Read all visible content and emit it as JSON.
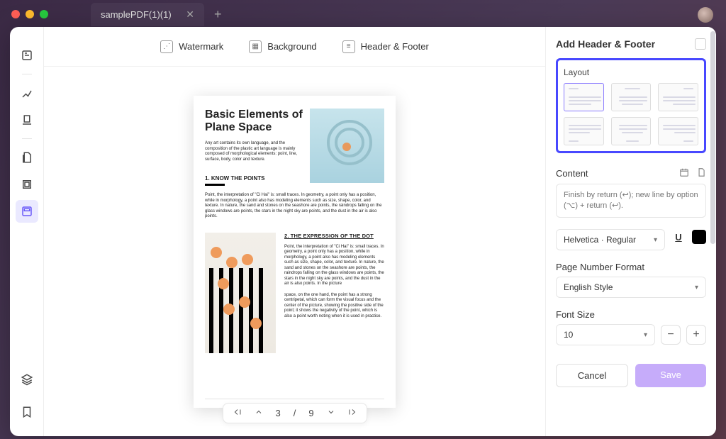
{
  "window": {
    "tab_title": "samplePDF(1)(1)"
  },
  "toolbar": {
    "watermark": "Watermark",
    "background": "Background",
    "header_footer": "Header & Footer"
  },
  "page_nav": {
    "current": "3",
    "sep": "/",
    "total": "9"
  },
  "document": {
    "title": "Basic Elements of Plane Space",
    "intro": "Any art contains its own language, and the composition of the plastic art language is mainly composed of morphological elements: point, line, surface, body, color and texture.",
    "section1_heading": "1. KNOW THE POINTS",
    "section1_body": "Point, the interpretation of \"Ci Hai\" is: small traces. In geometry, a point only has a position, while in morphology, a point also has modeling elements such as size, shape, color, and texture. In nature, the sand and stones on the seashore are points, the raindrops falling on the glass windows are points, the stars in the night sky are points, and the dust in the air is also points.",
    "section2_heading": "2. THE EXPRESSION OF THE DOT",
    "section2_p1": "Point, the interpretation of \"Ci Hai\" is: small traces. In geometry, a point only has a position, while in morphology, a point also has modeling elements such as size, shape, color, and texture. In nature, the sand and stones on the seashore are points, the raindrops falling on the glass windows are points, the stars in the night sky are points, and the dust in the air is also points. In the picture",
    "section2_p2": "space, on the one hand, the point has a strong centripetal, which can form the visual focus and the center of the picture, showing the positive side of the point; it shows the negativity of the point, which is also a point worth noting when it is used in practice."
  },
  "panel": {
    "title": "Add Header & Footer",
    "layout_label": "Layout",
    "content_label": "Content",
    "content_placeholder": "Finish by return (↩); new line by option (⌥) + return (↩).",
    "font_family": "Helvetica · Regular",
    "pagenum_label": "Page Number Format",
    "pagenum_value": "English Style",
    "fontsize_label": "Font Size",
    "fontsize_value": "10",
    "cancel": "Cancel",
    "save": "Save"
  }
}
